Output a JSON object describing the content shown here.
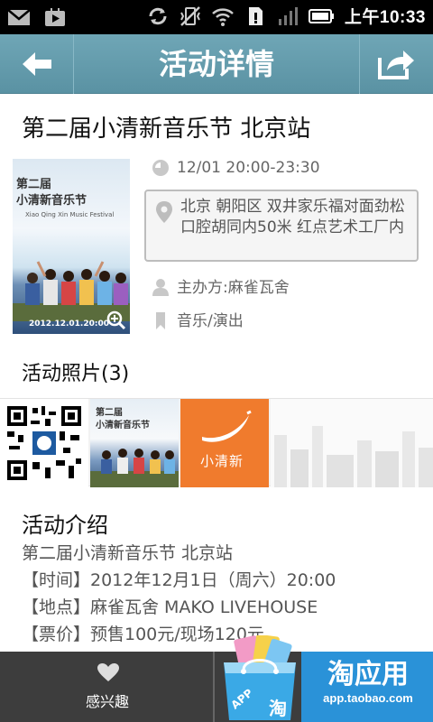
{
  "status_bar": {
    "time": "上午10:33",
    "icons": [
      "gmail-icon",
      "play-store-icon",
      "sync-icon",
      "vibrate-off-icon",
      "wifi-icon",
      "sim-icon",
      "signal-icon",
      "battery-icon"
    ]
  },
  "header": {
    "title": "活动详情",
    "back_icon": "arrow-left-icon",
    "share_icon": "share-icon"
  },
  "event": {
    "title": "第二届小清新音乐节 北京站",
    "poster": {
      "caption_line1": "第二届",
      "caption_line2": "小清新音乐节",
      "subtitle": "Xiao Qing Xin Music Festival",
      "date": "2012.12.01.20:00"
    },
    "time": "12/01 20:00-23:30",
    "address": "北京 朝阳区 双井家乐福对面劲松口腔胡同内50米 红点艺术工厂内",
    "organizer": "主办方:麻雀瓦舍",
    "category": "音乐/演出"
  },
  "photos": {
    "heading": "活动照片(3)",
    "orange_label": "小清新"
  },
  "intro": {
    "heading": "活动介绍",
    "lines": [
      "第二届小清新音乐节 北京站",
      "【时间】2012年12月1日（周六）20:00",
      "【地点】麻雀瓦舍 MAKO LIVEHOUSE",
      "【票价】预售100元/现场120元"
    ]
  },
  "bottom_bar": {
    "like_label": "感兴趣",
    "promo_title": "淘应用",
    "promo_url": "app.taobao.com",
    "promo_bag_text": "APP",
    "promo_bag_char": "淘"
  },
  "colors": {
    "header": "#5f98a9",
    "bottom_bar": "#3d3d3d",
    "promo_blue": "#2a92d8",
    "orange": "#f07b2d"
  }
}
